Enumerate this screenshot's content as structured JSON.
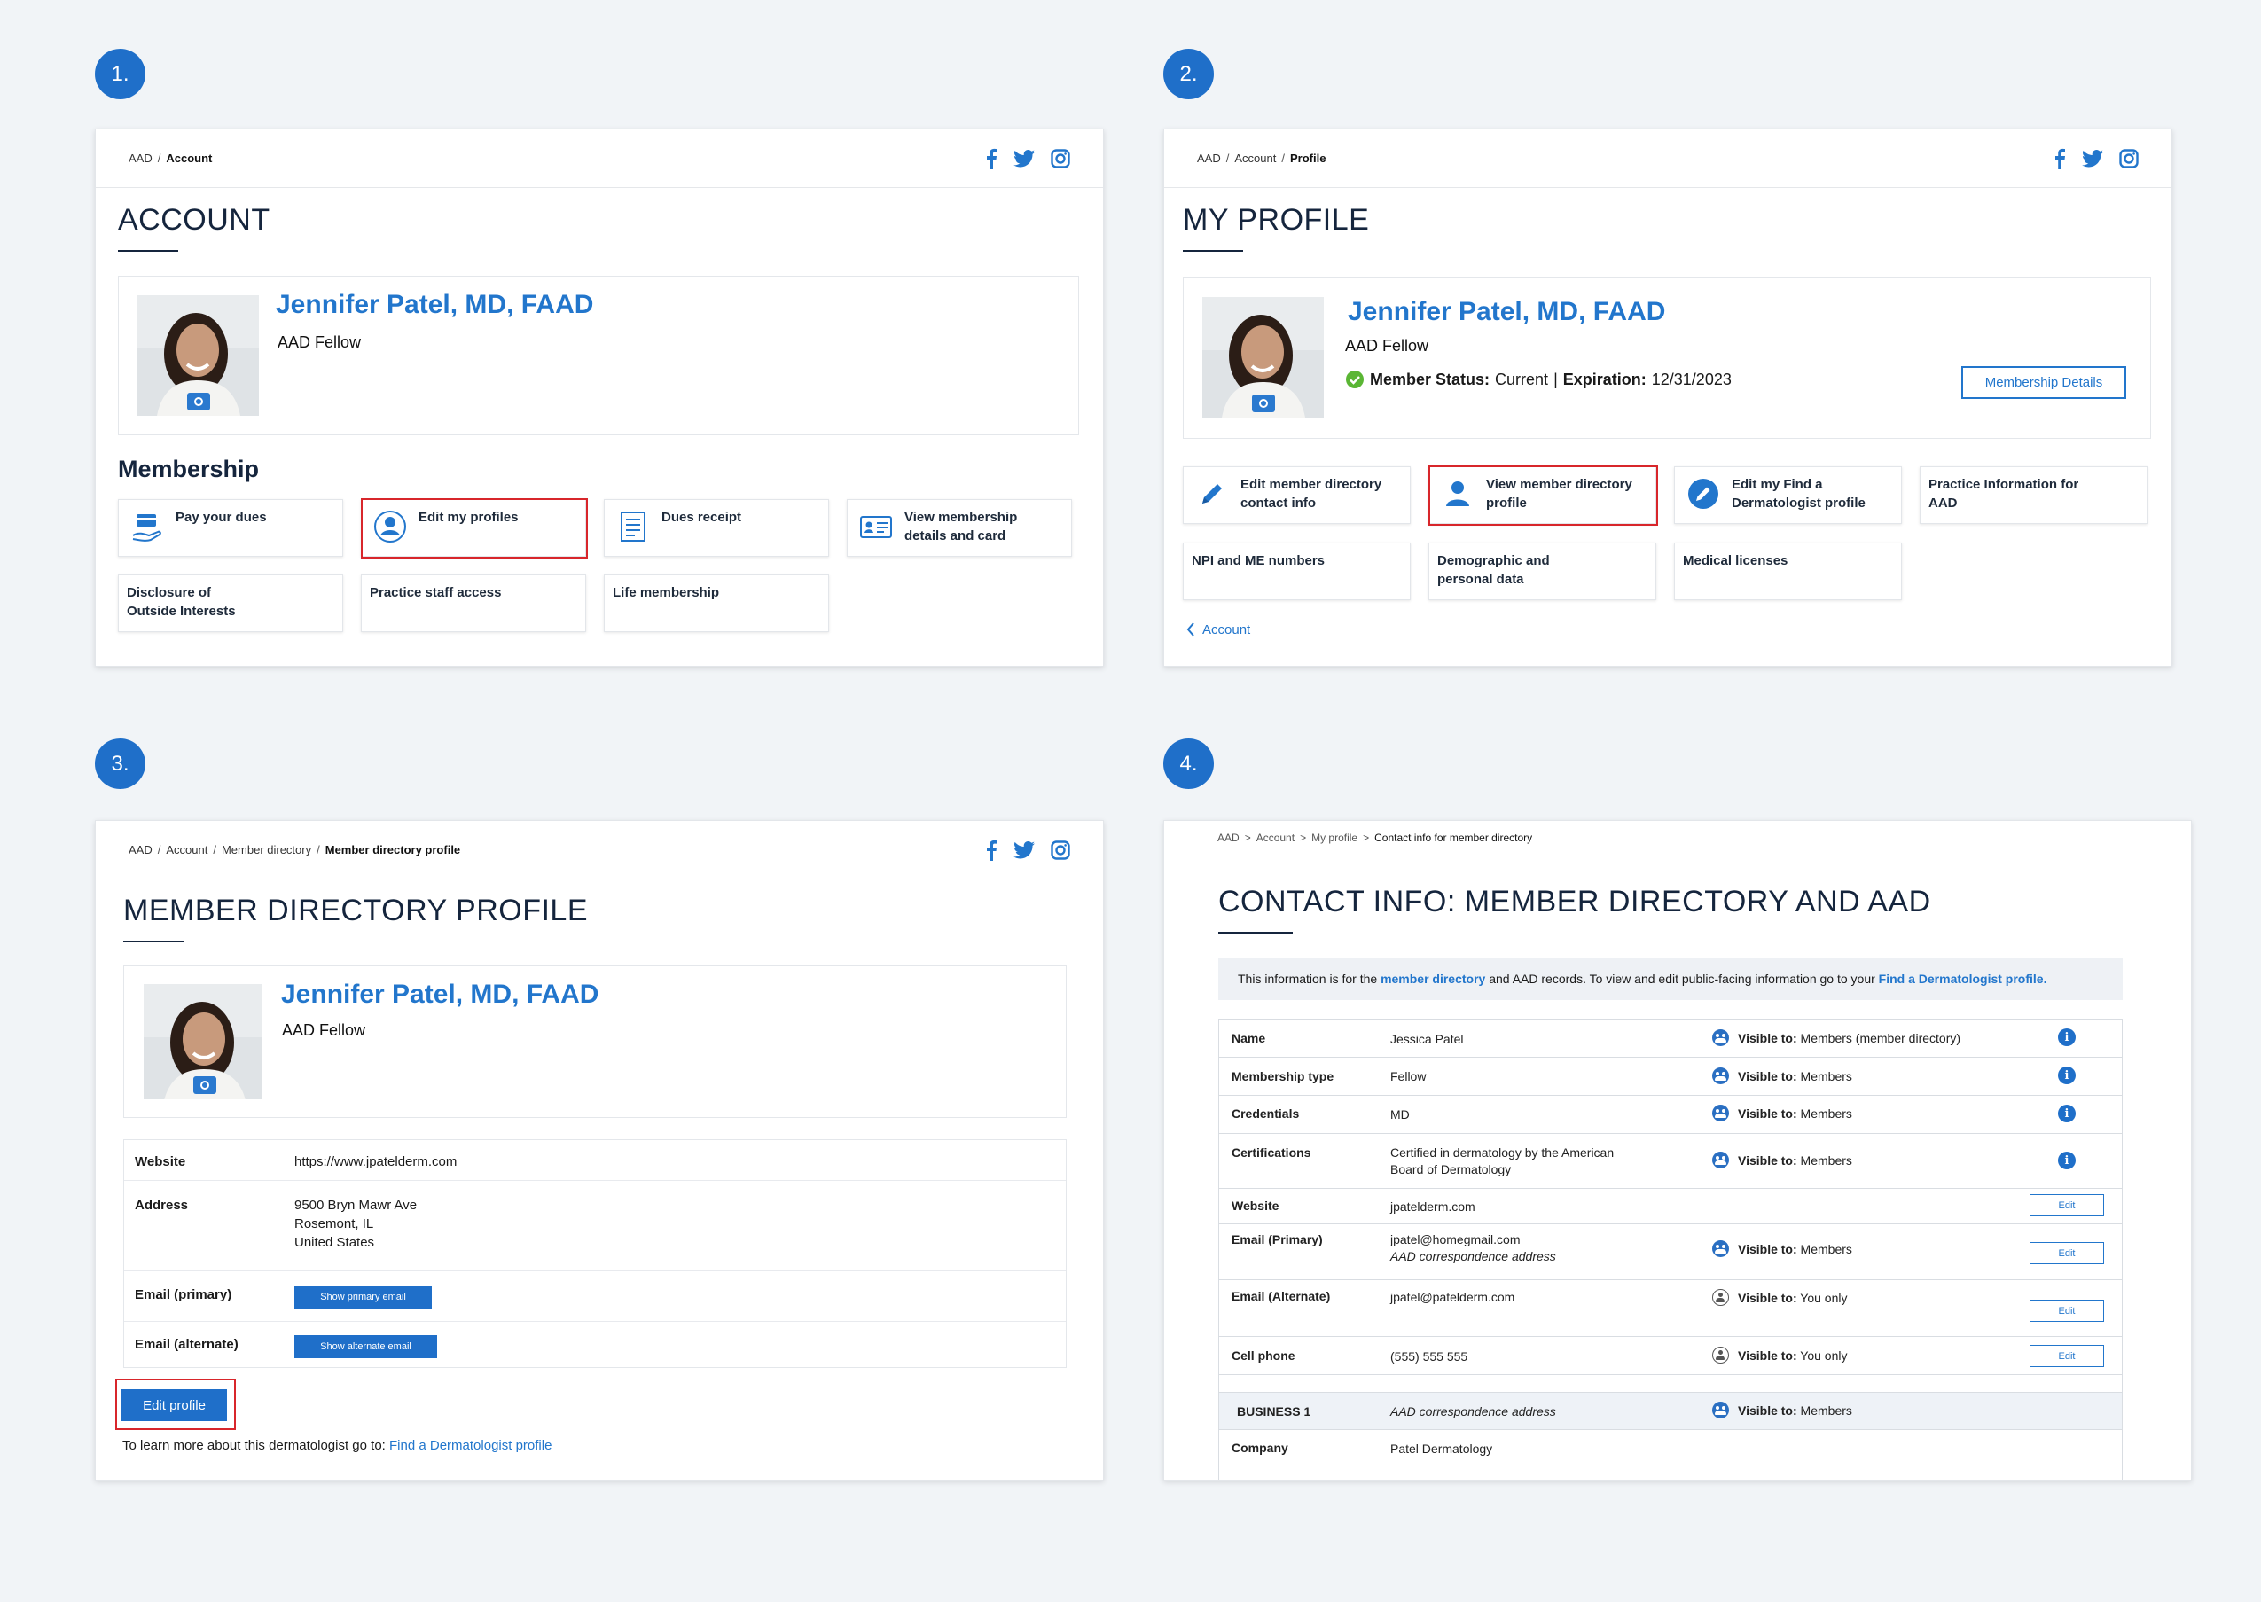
{
  "steps": [
    "1.",
    "2.",
    "3.",
    "4."
  ],
  "colors": {
    "accent": "#1f6fc9",
    "highlight": "#d8262b",
    "title": "#15253d",
    "bg": "#f1f4f7"
  },
  "profile": {
    "name": "Jennifer Patel, MD, FAAD",
    "role": "AAD Fellow"
  },
  "p1": {
    "crumbs": [
      "AAD",
      "Account"
    ],
    "title": "ACCOUNT",
    "section": "Membership",
    "cards": [
      {
        "label": "Pay your dues",
        "icon": "hand-card-icon"
      },
      {
        "label": "Edit my profiles",
        "icon": "user-circle-icon"
      },
      {
        "label": "Dues receipt",
        "icon": "receipt-icon"
      },
      {
        "label": "View membership details and card",
        "icon": "id-card-icon"
      },
      {
        "label": "Disclosure of Outside Interests"
      },
      {
        "label": "Practice staff access"
      },
      {
        "label": "Life membership"
      }
    ]
  },
  "p2": {
    "crumbs": [
      "AAD",
      "Account",
      "Profile"
    ],
    "title": "MY PROFILE",
    "status_label": "Member Status:",
    "status_value": "Current",
    "divider": "|",
    "exp_label": "Expiration:",
    "exp_value": "12/31/2023",
    "details_button": "Membership Details",
    "cards": [
      {
        "label": "Edit member directory contact info",
        "icon": "pencil-icon"
      },
      {
        "label": "View member directory profile",
        "icon": "person-icon"
      },
      {
        "label": "Edit my Find a Dermatologist profile",
        "icon": "pencil-circle-icon"
      },
      {
        "label": "Practice Information for AAD"
      },
      {
        "label": "NPI and ME numbers"
      },
      {
        "label": "Demographic and personal data"
      },
      {
        "label": "Medical licenses"
      }
    ],
    "back_link": "Account"
  },
  "p3": {
    "crumbs": [
      "AAD",
      "Account",
      "Member directory",
      "Member directory profile"
    ],
    "title": "MEMBER DIRECTORY PROFILE",
    "rows": [
      {
        "label": "Website",
        "value": "https://www.jpatelderm.com"
      },
      {
        "label": "Address",
        "lines": [
          "9500 Bryn Mawr Ave",
          "Rosemont, IL",
          "United States"
        ]
      },
      {
        "label": "Email (primary)",
        "button": "Show primary email"
      },
      {
        "label": "Email (alternate)",
        "button": "Show alternate email"
      }
    ],
    "edit_button": "Edit profile",
    "learn_more": "To learn more about this dermatologist go to:",
    "learn_link": "Find a Dermatologist profile"
  },
  "p4": {
    "crumbs": [
      "AAD",
      "Account",
      "My profile",
      "Contact info for member directory"
    ],
    "title": "CONTACT INFO: MEMBER DIRECTORY AND AAD",
    "notice": {
      "t1": "This information is for the",
      "l1": "member directory",
      "t2": "and AAD records. To view and edit public-facing information go to your",
      "l2": "Find a Dermatologist profile."
    },
    "visible_label": "Visible to:",
    "edit_label": "Edit",
    "rows": [
      {
        "label": "Name",
        "value": "Jessica Patel",
        "visible": "Members (member directory)",
        "icon": "group",
        "info": true
      },
      {
        "label": "Membership type",
        "value": "Fellow",
        "visible": "Members",
        "icon": "group",
        "info": true
      },
      {
        "label": "Credentials",
        "value": "MD",
        "visible": "Members",
        "icon": "group",
        "info": true
      },
      {
        "label": "Certifications",
        "value": "Certified in dermatology by the American",
        "value2": "Board of Dermatology",
        "visible": "Members",
        "icon": "group",
        "info": true
      },
      {
        "label": "Website",
        "value": "jpatelderm.com",
        "edit": true
      },
      {
        "label": "Email (Primary)",
        "value": "jpatel@homegmail.com",
        "value2": "AAD correspondence address",
        "visible": "Members",
        "icon": "group",
        "edit": true
      },
      {
        "label": "Email (Alternate)",
        "value": "jpatel@patelderm.com",
        "visible": "You only",
        "icon": "me",
        "edit": true
      },
      {
        "label": "Cell phone",
        "value": "(555) 555 555",
        "visible": "You only",
        "icon": "me",
        "edit": true
      }
    ],
    "business": {
      "label": "BUSINESS 1",
      "value": "AAD correspondence address",
      "visible": "Members"
    },
    "company": {
      "label": "Company",
      "value": "Patel Dermatology"
    }
  }
}
